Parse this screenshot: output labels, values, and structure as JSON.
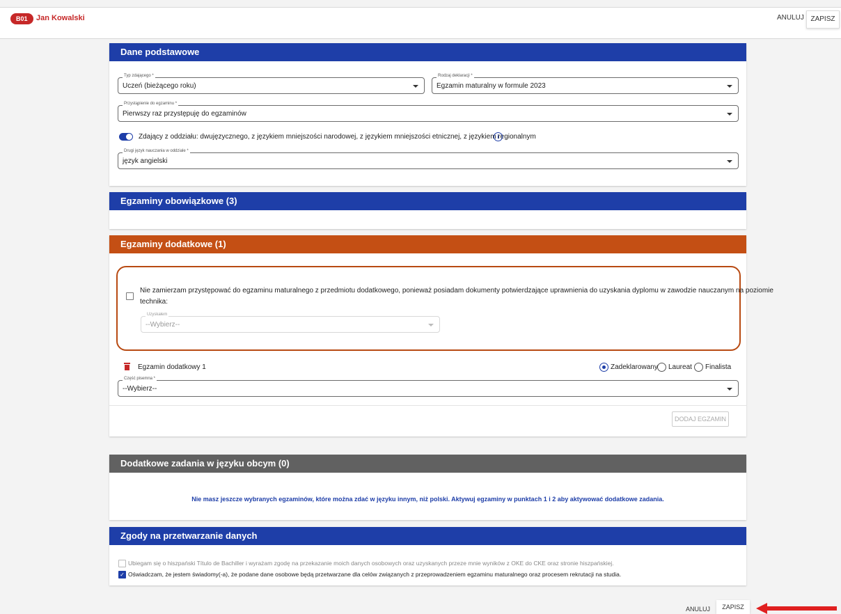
{
  "header": {
    "badge": "B01",
    "student_name": "Jan Kowalski",
    "cancel_label": "ANULUJ",
    "save_label": "ZAPISZ"
  },
  "basic": {
    "title": "Dane podstawowe",
    "type_label": "Typ zdającego *",
    "type_value": "Uczeń (bieżącego roku)",
    "declaration_label": "Rodzaj deklaracji *",
    "declaration_value": "Egzamin maturalny w formule 2023",
    "approach_label": "Przystąpienie do egzaminu *",
    "approach_value": "Pierwszy raz przystępuję do egzaminów",
    "toggle_text": "Zdający z oddziału: dwujęzycznego, z językiem mniejszości narodowej, z językiem mniejszości etnicznej, z językiem regionalnym",
    "second_lang_label": "Drugi język nauczania w oddziale *",
    "second_lang_value": "język angielski"
  },
  "mandatory": {
    "title": "Egzaminy obowiązkowe (3)"
  },
  "additional": {
    "title": "Egzaminy dodatkowe (1)",
    "checkbox_text_1": "Nie zamierzam przystępować do egzaminu maturalnego z przedmiotu dodatkowego, ponieważ posiadam dokumenty potwierdzające uprawnienia do uzyskania dyplomu w zawodzie nauczanym na poziomie",
    "checkbox_text_2": "technika:",
    "obtained_label": "Uzyskałem",
    "obtained_value": "--Wybierz--",
    "exam_name": "Egzamin dodatkowy 1",
    "radio_declared": "Zadeklarowany",
    "radio_laureate": "Laureat",
    "radio_finalist": "Finalista",
    "written_label": "Część pisemna *",
    "written_value": "--Wybierz--",
    "add_exam_label": "DODAJ EGZAMIN"
  },
  "foreign": {
    "title": "Dodatkowe zadania w języku obcym (0)",
    "message": "Nie masz jeszcze wybranych egzaminów, które można zdać w języku innym, niż polski. Aktywuj egzaminy w punktach 1 i 2 aby aktywować dodatkowe zadania."
  },
  "consents": {
    "title": "Zgody na przetwarzanie danych",
    "consent_1": "Ubiegam się o hiszpański Título de Bachiller i wyrażam zgodę na przekazanie moich danych osobowych oraz uzyskanych przeze mnie wyników z OKE do CKE oraz stronie hiszpańskiej.",
    "consent_2": "Oświadczam, że jestem świadomy(-a), że podane dane osobowe będą przetwarzane dla celów związanych z przeprowadzeniem egzaminu maturalnego oraz procesem rekrutacji na studia."
  },
  "footer": {
    "cancel_label": "ANULUJ",
    "save_label": "ZAPISZ"
  },
  "colors": {
    "blue": "#1e3ea8",
    "orange": "#c44f14",
    "grey": "#616161",
    "red": "#c62828"
  },
  "icons": [
    "info-icon",
    "trash-icon",
    "check-icon",
    "arrow-left-icon"
  ]
}
